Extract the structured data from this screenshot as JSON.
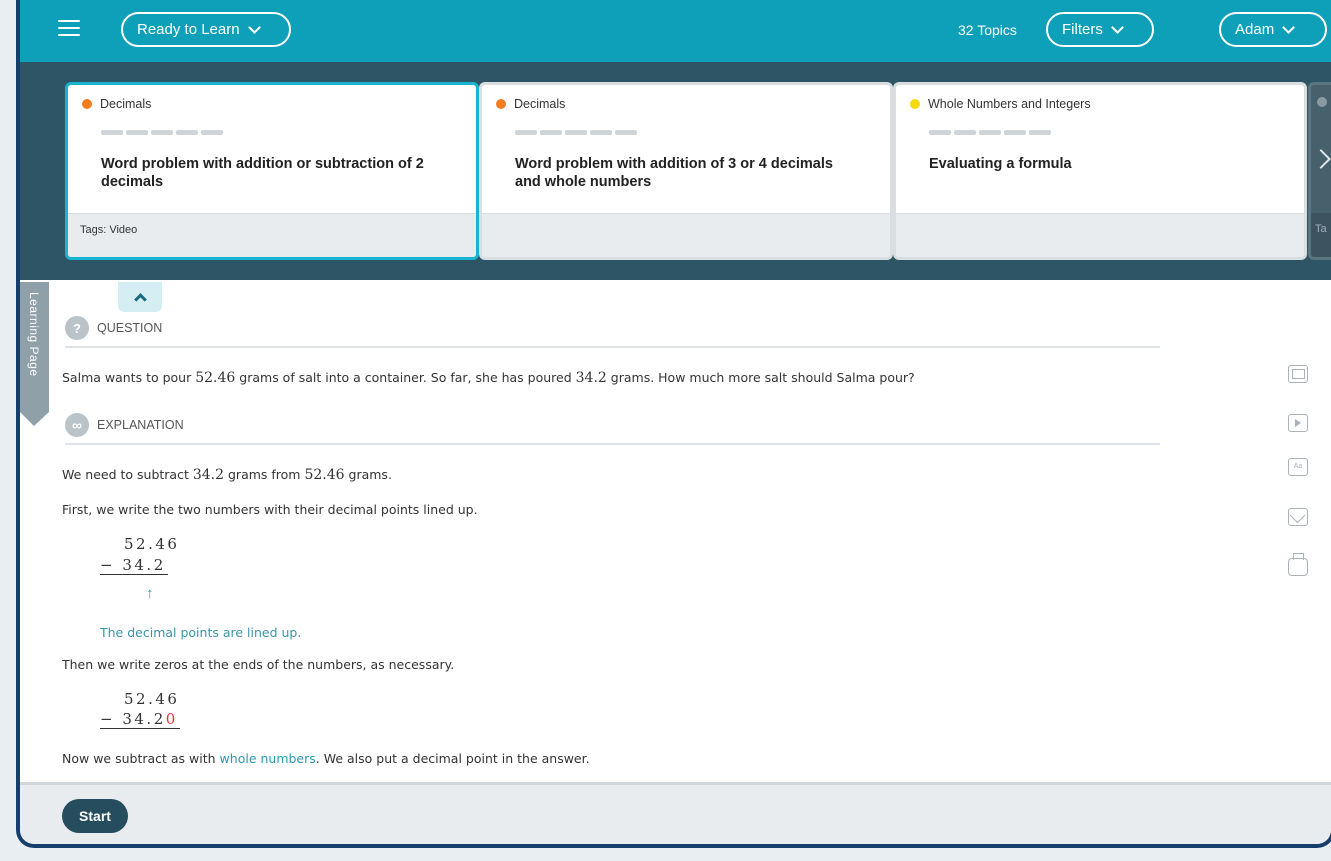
{
  "header": {
    "mode_label": "Ready to Learn",
    "topics_count": "32 Topics",
    "filters_label": "Filters",
    "user_label": "Adam"
  },
  "cards": [
    {
      "category": "Decimals",
      "category_color": "#f47b20",
      "title": "Word problem with addition or subtraction of 2 decimals",
      "tags": "Tags: Video"
    },
    {
      "category": "Decimals",
      "category_color": "#f47b20",
      "title": "Word problem with addition of 3 or 4 decimals and whole numbers",
      "tags": ""
    },
    {
      "category": "Whole Numbers and Integers",
      "category_color": "#f5d90a",
      "title": "Evaluating a formula",
      "tags": ""
    },
    {
      "category": "",
      "category_color": "#8a9aa2",
      "title": "",
      "tags": "Ta"
    }
  ],
  "sidebar": {
    "learning_page_label": "Learning Page"
  },
  "question": {
    "heading": "QUESTION",
    "icon": "?",
    "text_parts": [
      "Salma wants to pour ",
      "52.46",
      " grams of salt into a container. So far, she has poured ",
      "34.2",
      " grams. How much more salt should Salma pour?"
    ]
  },
  "explanation": {
    "heading": "EXPLANATION",
    "icon": "∞",
    "line1_parts": [
      "We need to subtract ",
      "34.2",
      " grams from ",
      "52.46",
      " grams."
    ],
    "line2": "First, we write the two numbers with their decimal points lined up.",
    "calc1": {
      "top": "52.46",
      "bottom": "− 34.2"
    },
    "note": "The decimal points are lined up.",
    "line3": "Then we write zeros at the ends of the numbers, as necessary.",
    "calc2": {
      "top": "52.46",
      "bottom": "− 34.2",
      "added_zero": "0"
    },
    "line4_parts": [
      "Now we subtract as with ",
      "whole numbers",
      ". We also put a decimal point in the answer."
    ]
  },
  "tools": [
    "calculator-icon",
    "video-icon",
    "dictionary-icon",
    "mail-icon",
    "print-icon"
  ],
  "footer": {
    "start_label": "Start"
  }
}
